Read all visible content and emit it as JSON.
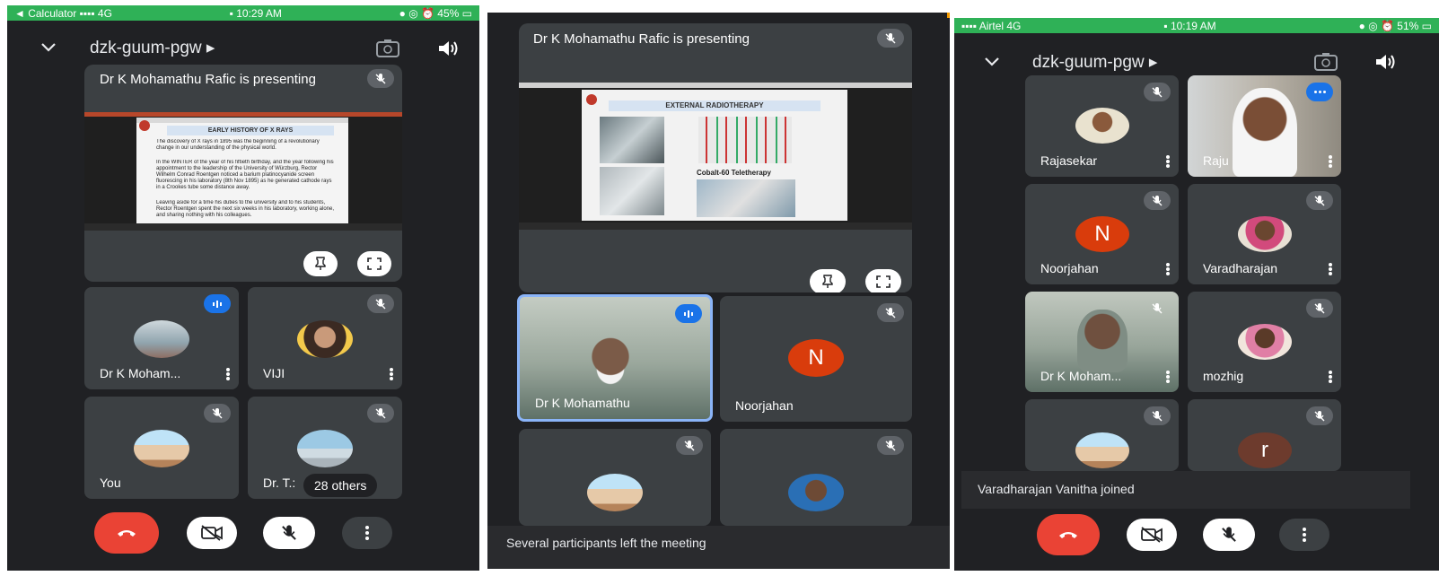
{
  "colors": {
    "background": "#202124",
    "tile": "#3c4043",
    "status_green": "#2fb157",
    "end_call_red": "#ea4335",
    "speaking_blue": "#1a73e8",
    "avatar_n": "#d93c0c",
    "avatar_r": "#6d3b2d"
  },
  "screen1": {
    "status": {
      "left": "◄ Calculator ▪▪▪▪ 4G",
      "time": "▪ 10:29 AM",
      "right": "● ◎ ⏰ 45% ▭"
    },
    "meeting_code": "dzk-guum-pgw ▸",
    "presenting": "Dr K Mohamathu Rafic is presenting",
    "slide": {
      "title": "EARLY HISTORY OF X RAYS",
      "bullets": [
        "The discovery of X rays in 1895 was the beginning of a revolutionary change in our understanding of the physical world.",
        "In the WINTER of the year of his fiftieth birthday, and the year following his appointment to the leadership of the University of Würzburg, Rector Wilhelm Conrad Roentgen noticed a barium platinocyanide screen fluorescing in his laboratory (8th Nov 1895) as he generated cathode rays in a Crookes tube some distance away.",
        "Leaving aside for a time his duties to the university and to his students, Rector Roentgen spent the next six weeks in his laboratory, working alone, and sharing nothing with his colleagues."
      ]
    },
    "tiles": [
      "Dr K Moham...",
      "VIJI",
      "You",
      "Dr. T.:"
    ],
    "others": "28 others"
  },
  "screen2": {
    "presenting": "Dr K Mohamathu Rafic is presenting",
    "slide": {
      "title": "EXTERNAL RADIOTHERAPY",
      "caption": "Cobalt-60 Teletherapy"
    },
    "tiles": [
      "Dr K Mohamathu",
      "Noorjahan"
    ],
    "avatar_letter": "N",
    "toast": "Several participants left the meeting"
  },
  "screen3": {
    "status": {
      "left": "▪▪▪▪ Airtel 4G",
      "time": "▪ 10:19 AM",
      "right": "● ◎ ⏰ 51% ▭"
    },
    "meeting_code": "dzk-guum-pgw ▸",
    "tiles": [
      "Rajasekar",
      "Raju",
      "Noorjahan",
      "Varadharajan",
      "Dr K Moham...",
      "mozhig"
    ],
    "avatar_n": "N",
    "avatar_r": "r",
    "toast": "Varadharajan Vanitha joined"
  }
}
